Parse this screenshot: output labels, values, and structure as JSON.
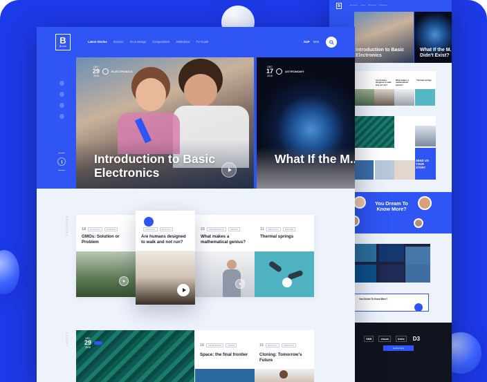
{
  "brand": {
    "letter": "B",
    "name": "Bruno"
  },
  "nav": {
    "links": [
      "Latest Stories",
      "Science",
      "Art & Design",
      "Compositions",
      "Institutions",
      "TV Guide"
    ],
    "right": [
      "SUP",
      "Web"
    ]
  },
  "hero": [
    {
      "month": "DEC",
      "day": "29",
      "year": "2016",
      "category": "ELECTRONICS",
      "title": "Introduction to Basic Electronics"
    },
    {
      "month": "DEC",
      "day": "17",
      "year": "2016",
      "category": "ASTRONOMY",
      "title": "What If the M... Didn't Exist?"
    }
  ],
  "sections": {
    "featured": "FEATURED",
    "latest": "LATEST"
  },
  "featured": [
    {
      "num": "18",
      "tags": [
        "ECOLOGY",
        "SCIENCE"
      ],
      "title": "GMOs: Solution or Problem"
    },
    {
      "num": "",
      "tags": [
        "ANATOMY",
        "BIOLOGY"
      ],
      "title": "Are humans designed to walk and not run?"
    },
    {
      "num": "15",
      "tags": [
        "MATHEMATICS",
        "GENIUS"
      ],
      "title": "What makes a mathematical genius?"
    },
    {
      "num": "11",
      "tags": [
        "GEOLOGY",
        "NATURE"
      ],
      "title": "Thermal springs"
    }
  ],
  "latest_hero": {
    "month": "DEC",
    "day": "29",
    "year": "2016"
  },
  "latest": [
    {
      "num": "16",
      "tags": [
        "ASTRONOMY",
        "SPACE"
      ],
      "title": "Space: the final frontier"
    },
    {
      "num": "15",
      "tags": [
        "BIOLOGY",
        "GENETICS"
      ],
      "title": "Cloning: Tomorrow's Future"
    }
  ],
  "side": {
    "hero_titles": [
      "Introduction to Basic Electronics",
      "What If the M... Didn't Exist?"
    ],
    "grid1": [
      "Are humans designed to walk and not run?",
      "What makes a mathematical genius?",
      "Thermal springs"
    ],
    "send": "SEND US YOUR STORY",
    "dream": "You Dream To Know More?",
    "cta": "You Dream To Know More?",
    "brands": [
      "SBB",
      "visual",
      "Unite",
      "D3"
    ],
    "footer_btn": "Send Us Story"
  },
  "colors": {
    "accent": "#2f55f4",
    "background": "#1d3ae8",
    "page": "#eef2fb"
  }
}
